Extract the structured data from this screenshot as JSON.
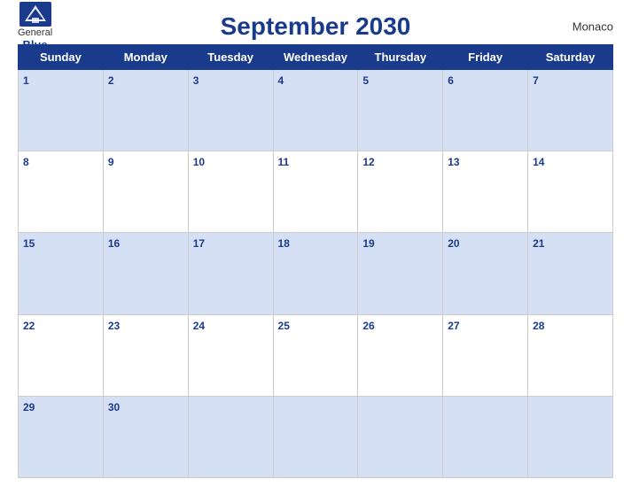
{
  "header": {
    "title": "September 2030",
    "country": "Monaco",
    "logo_general": "General",
    "logo_blue": "Blue"
  },
  "days_of_week": [
    "Sunday",
    "Monday",
    "Tuesday",
    "Wednesday",
    "Thursday",
    "Friday",
    "Saturday"
  ],
  "weeks": [
    [
      {
        "day": 1
      },
      {
        "day": 2
      },
      {
        "day": 3
      },
      {
        "day": 4
      },
      {
        "day": 5
      },
      {
        "day": 6
      },
      {
        "day": 7
      }
    ],
    [
      {
        "day": 8
      },
      {
        "day": 9
      },
      {
        "day": 10
      },
      {
        "day": 11
      },
      {
        "day": 12
      },
      {
        "day": 13
      },
      {
        "day": 14
      }
    ],
    [
      {
        "day": 15
      },
      {
        "day": 16
      },
      {
        "day": 17
      },
      {
        "day": 18
      },
      {
        "day": 19
      },
      {
        "day": 20
      },
      {
        "day": 21
      }
    ],
    [
      {
        "day": 22
      },
      {
        "day": 23
      },
      {
        "day": 24
      },
      {
        "day": 25
      },
      {
        "day": 26
      },
      {
        "day": 27
      },
      {
        "day": 28
      }
    ],
    [
      {
        "day": 29
      },
      {
        "day": 30
      },
      {
        "day": null
      },
      {
        "day": null
      },
      {
        "day": null
      },
      {
        "day": null
      },
      {
        "day": null
      }
    ]
  ],
  "colors": {
    "header_bg": "#1a3a8c",
    "row_odd_bg": "#d6e0f5",
    "row_even_bg": "#ffffff"
  }
}
